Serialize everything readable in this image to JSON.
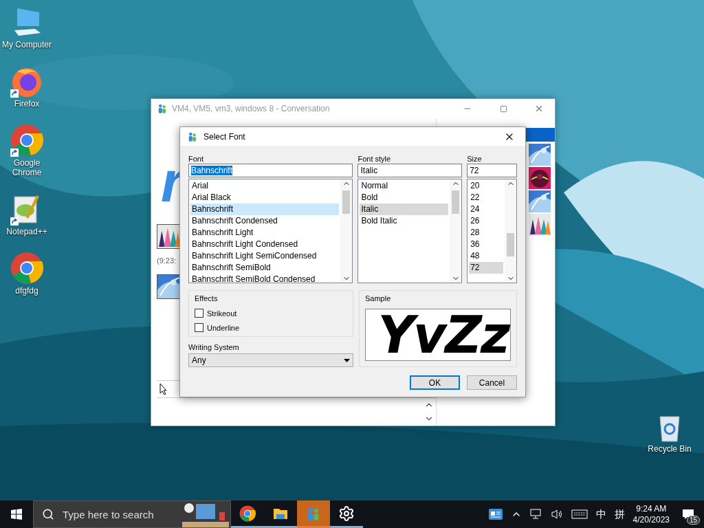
{
  "desktop_icons": [
    {
      "label": "My Computer",
      "kind": "computer",
      "shortcut": false
    },
    {
      "label": "Firefox",
      "kind": "firefox",
      "shortcut": true
    },
    {
      "label": "Google Chrome",
      "kind": "chrome",
      "shortcut": true
    },
    {
      "label": "Notepad++",
      "kind": "notepad",
      "shortcut": true
    },
    {
      "label": "dfgfdg",
      "kind": "chrome",
      "shortcut": false
    }
  ],
  "recycle_bin": {
    "label": "Recycle Bin"
  },
  "conversation_window": {
    "title": "VM4, VM5, vm3, windows 8 - Conversation",
    "big_text": "r",
    "timestamp": "(9:23:"
  },
  "font_dialog": {
    "title": "Select Font",
    "font": {
      "label": "Font",
      "value": "Bahnschrift",
      "items": [
        {
          "label": "Arial",
          "selected": false
        },
        {
          "label": "Arial Black",
          "selected": false
        },
        {
          "label": "Bahnschrift",
          "selected": true
        },
        {
          "label": "Bahnschrift Condensed",
          "selected": false
        },
        {
          "label": "Bahnschrift Light",
          "selected": false
        },
        {
          "label": "Bahnschrift Light Condensed",
          "selected": false
        },
        {
          "label": "Bahnschrift Light SemiCondensed",
          "selected": false
        },
        {
          "label": "Bahnschrift SemiBold",
          "selected": false
        },
        {
          "label": "Bahnschrift SemiBold Condensed",
          "selected": false
        }
      ]
    },
    "style": {
      "label": "Font style",
      "value": "Italic",
      "items": [
        {
          "label": "Normal",
          "selected": false
        },
        {
          "label": "Bold",
          "selected": false
        },
        {
          "label": "Italic",
          "selected": true
        },
        {
          "label": "Bold Italic",
          "selected": false
        }
      ]
    },
    "size": {
      "label": "Size",
      "value": "72",
      "items": [
        {
          "label": "20",
          "selected": false
        },
        {
          "label": "22",
          "selected": false
        },
        {
          "label": "24",
          "selected": false
        },
        {
          "label": "26",
          "selected": false
        },
        {
          "label": "28",
          "selected": false
        },
        {
          "label": "36",
          "selected": false
        },
        {
          "label": "48",
          "selected": false
        },
        {
          "label": "72",
          "selected": true
        }
      ]
    },
    "effects": {
      "label": "Effects",
      "options": [
        {
          "label": "Strikeout",
          "checked": false
        },
        {
          "label": "Underline",
          "checked": false
        }
      ]
    },
    "writing_system": {
      "label": "Writing System",
      "value": "Any"
    },
    "sample": {
      "label": "Sample",
      "text": "YvZz"
    },
    "buttons": [
      {
        "label": "OK",
        "default": true
      },
      {
        "label": "Cancel",
        "default": false
      }
    ]
  },
  "taskbar": {
    "search_placeholder": "Type here to search",
    "apps": [
      {
        "kind": "chrome",
        "active": false
      },
      {
        "kind": "folder",
        "active": false
      },
      {
        "kind": "messenger",
        "active": true
      },
      {
        "kind": "settings",
        "active": false
      }
    ],
    "ime": "中",
    "ime_mode": "拼",
    "time": "9:24 AM",
    "date": "4/20/2023",
    "notifications": "15"
  }
}
